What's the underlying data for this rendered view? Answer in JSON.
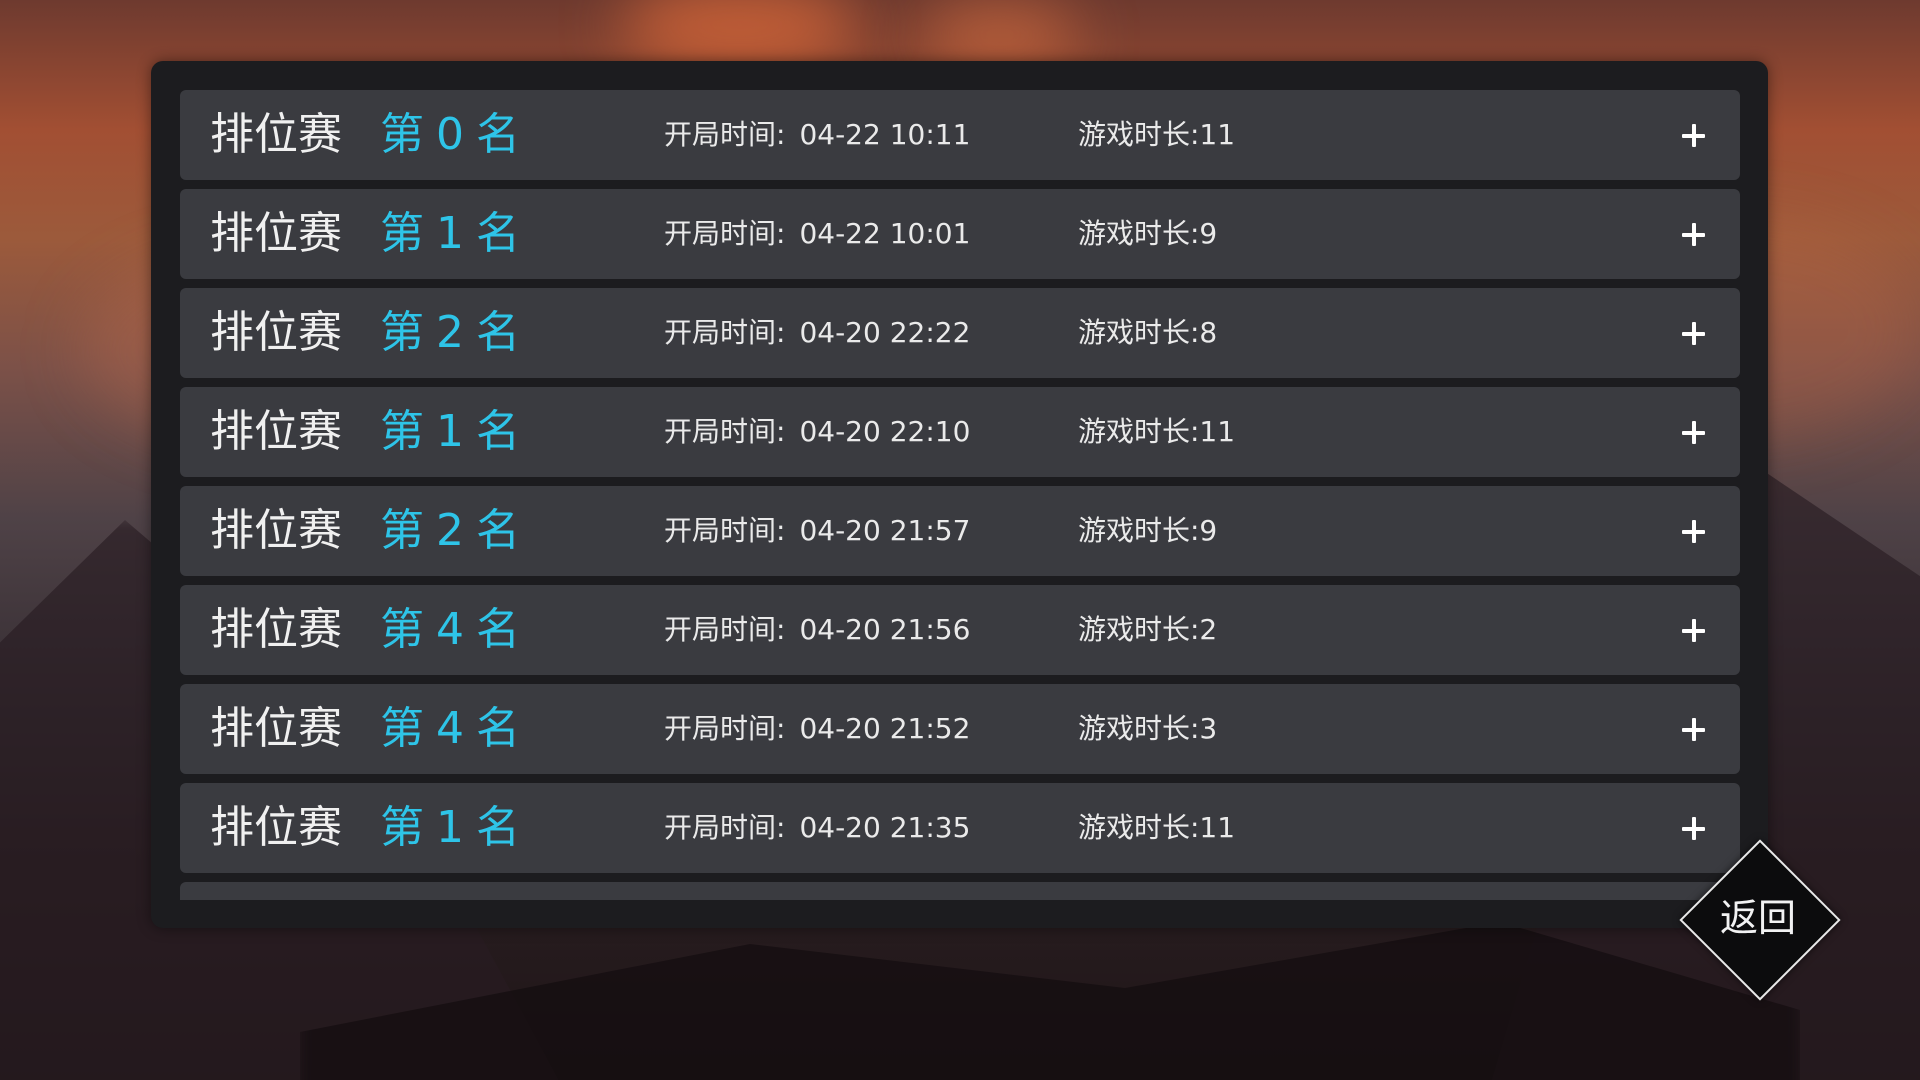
{
  "records": [
    {
      "mode": "排位赛",
      "rank_prefix": "第",
      "rank": "0",
      "rank_suffix": "名",
      "start_label": "开局时间:",
      "start_time": "04-22 10:11",
      "duration": "游戏时长:11"
    },
    {
      "mode": "排位赛",
      "rank_prefix": "第",
      "rank": "1",
      "rank_suffix": "名",
      "start_label": "开局时间:",
      "start_time": "04-22 10:01",
      "duration": "游戏时长:9"
    },
    {
      "mode": "排位赛",
      "rank_prefix": "第",
      "rank": "2",
      "rank_suffix": "名",
      "start_label": "开局时间:",
      "start_time": "04-20 22:22",
      "duration": "游戏时长:8"
    },
    {
      "mode": "排位赛",
      "rank_prefix": "第",
      "rank": "1",
      "rank_suffix": "名",
      "start_label": "开局时间:",
      "start_time": "04-20 22:10",
      "duration": "游戏时长:11"
    },
    {
      "mode": "排位赛",
      "rank_prefix": "第",
      "rank": "2",
      "rank_suffix": "名",
      "start_label": "开局时间:",
      "start_time": "04-20 21:57",
      "duration": "游戏时长:9"
    },
    {
      "mode": "排位赛",
      "rank_prefix": "第",
      "rank": "4",
      "rank_suffix": "名",
      "start_label": "开局时间:",
      "start_time": "04-20 21:56",
      "duration": "游戏时长:2"
    },
    {
      "mode": "排位赛",
      "rank_prefix": "第",
      "rank": "4",
      "rank_suffix": "名",
      "start_label": "开局时间:",
      "start_time": "04-20 21:52",
      "duration": "游戏时长:3"
    },
    {
      "mode": "排位赛",
      "rank_prefix": "第",
      "rank": "1",
      "rank_suffix": "名",
      "start_label": "开局时间:",
      "start_time": "04-20 21:35",
      "duration": "游戏时长:11"
    }
  ],
  "expand_icon": "plus-icon",
  "back_button": {
    "label": "返回"
  },
  "colors": {
    "panel": "#1c1c1f",
    "row": "#3a3b40",
    "rank_accent": "#2ec4e8",
    "text": "#eaeaea"
  }
}
